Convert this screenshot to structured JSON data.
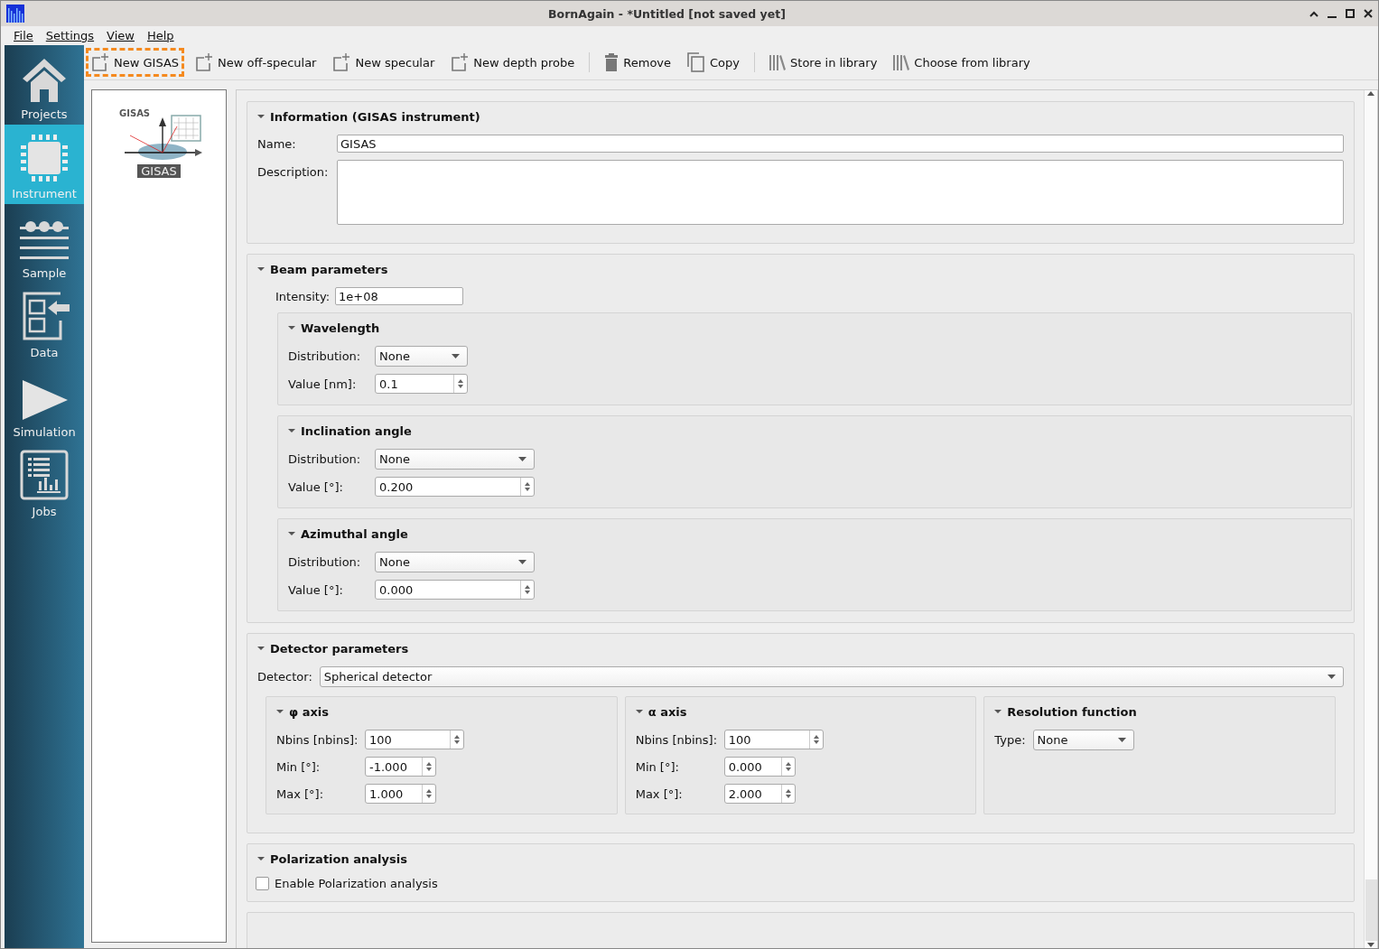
{
  "window": {
    "title": "BornAgain - *Untitled [not saved yet]"
  },
  "menu": [
    "File",
    "Settings",
    "View",
    "Help"
  ],
  "sidebar": {
    "items": [
      {
        "label": "Projects",
        "kind": "home",
        "selected": false
      },
      {
        "label": "Instrument",
        "kind": "chip",
        "selected": true
      },
      {
        "label": "Sample",
        "kind": "layers",
        "selected": false
      },
      {
        "label": "Data",
        "kind": "import",
        "selected": false
      },
      {
        "label": "Simulation",
        "kind": "play",
        "selected": false
      },
      {
        "label": "Jobs",
        "kind": "jobs",
        "selected": false
      }
    ]
  },
  "toolbar": [
    {
      "label": "New GISAS",
      "kind": "add",
      "separator_before": false,
      "highlighted": true
    },
    {
      "label": "New off-specular",
      "kind": "add",
      "separator_before": false,
      "highlighted": false
    },
    {
      "label": "New specular",
      "kind": "add",
      "separator_before": false,
      "highlighted": false
    },
    {
      "label": "New depth probe",
      "kind": "add",
      "separator_before": false,
      "highlighted": false
    },
    {
      "label": "Remove",
      "kind": "remove",
      "separator_before": true,
      "highlighted": false
    },
    {
      "label": "Copy",
      "kind": "copy",
      "separator_before": false,
      "highlighted": false
    },
    {
      "label": "Store in library",
      "kind": "library",
      "separator_before": true,
      "highlighted": false
    },
    {
      "label": "Choose from library",
      "kind": "library",
      "separator_before": false,
      "highlighted": false
    }
  ],
  "instruments": [
    {
      "caption": "GISAS",
      "label": "GISAS",
      "selected": true
    }
  ],
  "information": {
    "title": "Information (GISAS instrument)",
    "expanded": true,
    "name_label": "Name:",
    "name": "GISAS",
    "description_label": "Description:"
  },
  "beam": {
    "title": "Beam parameters",
    "expanded": true,
    "intensity_label": "Intensity:",
    "intensity": "1e+08",
    "groups": [
      {
        "title": "Wavelength",
        "expanded": true,
        "distribution_label": "Distribution:",
        "distribution": "None",
        "value_label": "Value [nm]:",
        "value": "0.1"
      },
      {
        "title": "Inclination angle",
        "expanded": true,
        "distribution_label": "Distribution:",
        "distribution": "None",
        "value_label": "Value [°]:",
        "value": "0.200"
      },
      {
        "title": "Azimuthal angle",
        "expanded": true,
        "distribution_label": "Distribution:",
        "distribution": "None",
        "value_label": "Value [°]:",
        "value": "0.000"
      }
    ]
  },
  "detector": {
    "title": "Detector parameters",
    "expanded": true,
    "detector_label": "Detector:",
    "detector": "Spherical detector",
    "axes": [
      {
        "title": "φ axis",
        "expanded": true,
        "rows": [
          {
            "label": "Nbins [nbins]:",
            "value": "100"
          },
          {
            "label": "Min [°]:",
            "value": "-1.000"
          },
          {
            "label": "Max [°]:",
            "value": "1.000"
          }
        ]
      },
      {
        "title": "α axis",
        "expanded": true,
        "rows": [
          {
            "label": "Nbins [nbins]:",
            "value": "100"
          },
          {
            "label": "Min [°]:",
            "value": "0.000"
          },
          {
            "label": "Max [°]:",
            "value": "2.000"
          }
        ]
      }
    ],
    "resolution": {
      "title": "Resolution function",
      "expanded": true,
      "type_label": "Type:",
      "type": "None"
    }
  },
  "polarization": {
    "title": "Polarization analysis",
    "expanded": true,
    "checkbox_label": "Enable Polarization analysis",
    "checked": false
  }
}
